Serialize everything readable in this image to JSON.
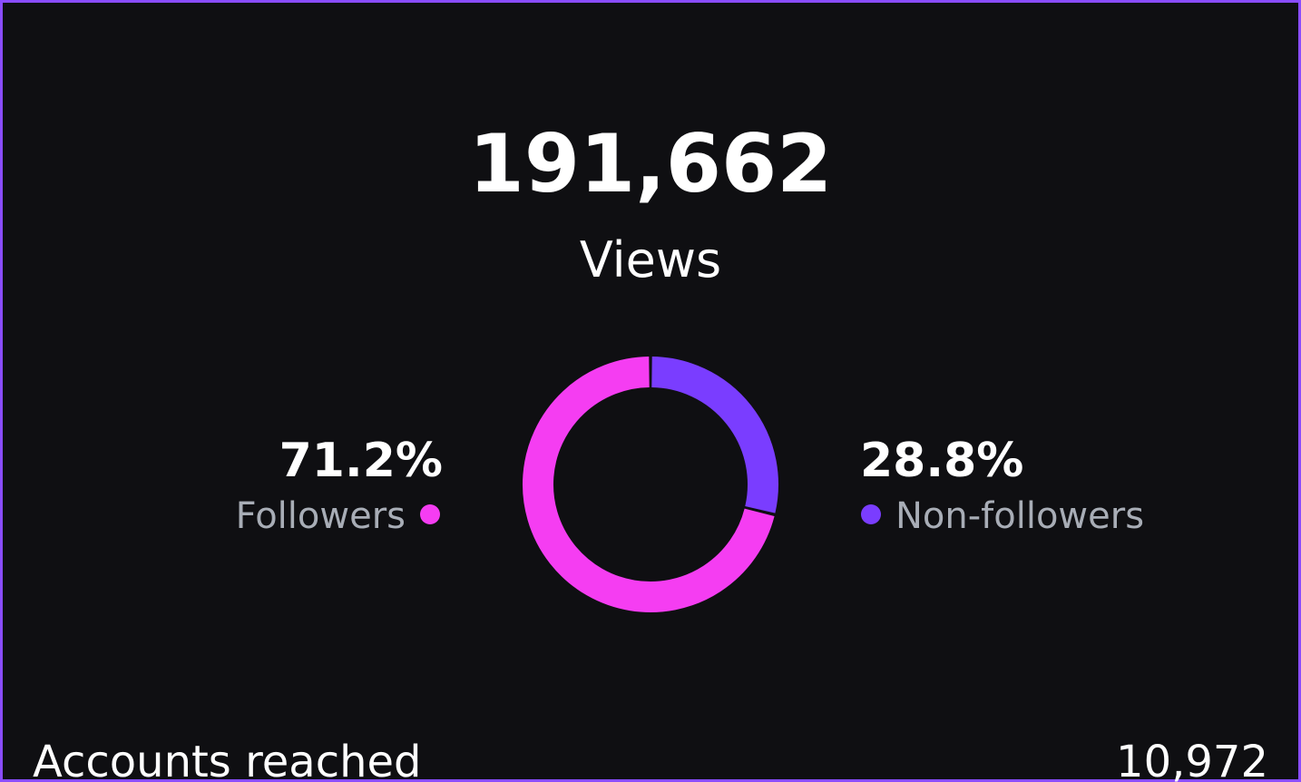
{
  "views": {
    "total": "191,662",
    "label": "Views"
  },
  "breakdown": {
    "followers": {
      "percent": "71.2%",
      "label": "Followers",
      "color": "#f53df2"
    },
    "non_followers": {
      "percent": "28.8%",
      "label": "Non-followers",
      "color": "#7a3dff"
    }
  },
  "accounts_reached": {
    "label": "Accounts reached",
    "value": "10,972"
  },
  "colors": {
    "background": "#0f0f12",
    "frame": "#8a4dff",
    "muted_text": "#a8adb6"
  },
  "chart_data": {
    "type": "pie",
    "categories": [
      "Followers",
      "Non-followers"
    ],
    "values": [
      71.2,
      28.8
    ],
    "colors": [
      "#f53df2",
      "#7a3dff"
    ],
    "title": "",
    "legend": "left-right"
  }
}
